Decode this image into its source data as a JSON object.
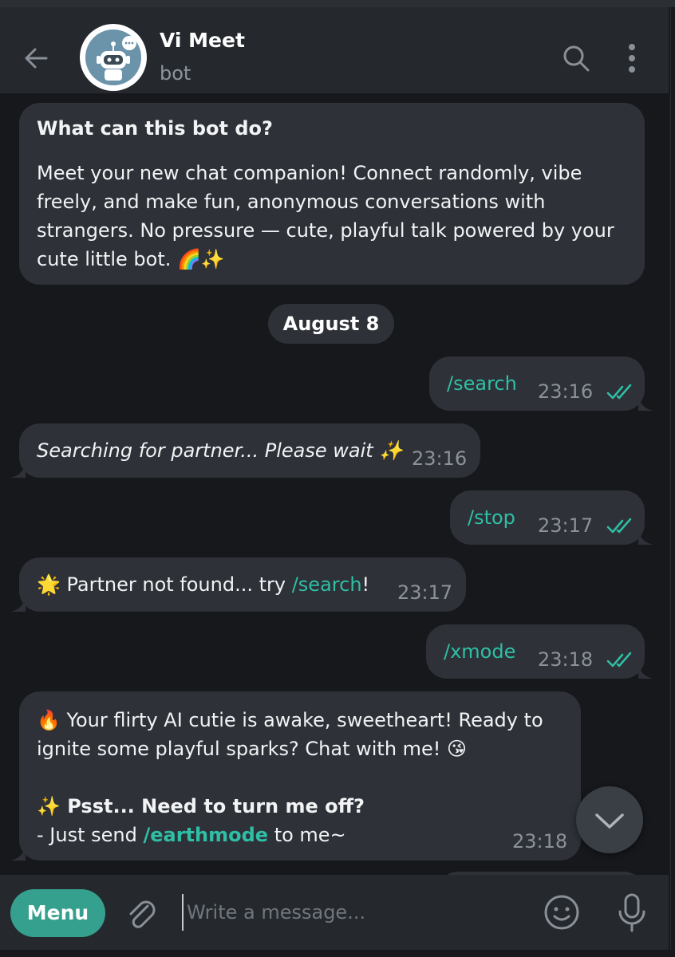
{
  "header": {
    "title": "Vi Meet",
    "subtitle": "bot",
    "icons": [
      "back-arrow-icon",
      "robot-avatar",
      "search-icon",
      "more-vertical-icon"
    ]
  },
  "intro": {
    "heading": "What can this bot do?",
    "lines": [
      "Meet your new chat companion! Connect randomly, vibe",
      "freely, and make fun, anonymous conversations with",
      "strangers. No pressure —  cute, playful talk powered by your",
      "cute little bot. 🌈✨"
    ]
  },
  "date_separator": "August 8",
  "messages": [
    {
      "dir": "out",
      "text": "/search",
      "time": "23:16",
      "status": "read"
    },
    {
      "dir": "in",
      "text": "Searching for partner... Please wait ✨",
      "time": "23:16"
    },
    {
      "dir": "out",
      "text": "/stop",
      "time": "23:17",
      "status": "read"
    },
    {
      "dir": "in",
      "prefix": "🌟 Partner not found... try ",
      "link": "/search",
      "suffix": "!",
      "time": "23:17"
    },
    {
      "dir": "out",
      "text": "/xmode",
      "time": "23:18",
      "status": "read"
    },
    {
      "dir": "in",
      "line1": "🔥 Your flirty AI cutie is awake, sweetheart! Ready to",
      "line2": "ignite some playful sparks? Chat with me! 😘",
      "bold": "✨ Psst... Need to turn me off?",
      "line4_prefix": "-  Just send ",
      "line4_link": "/earthmode",
      "line4_suffix": " to me~",
      "time": "23:18"
    }
  ],
  "input": {
    "menu_label": "Menu",
    "placeholder": "Write a message..."
  },
  "colors": {
    "accent": "#35a08d",
    "command": "#2fbfa6",
    "bubble": "#2e3137",
    "background": "#16181c",
    "header": "#25292e"
  }
}
